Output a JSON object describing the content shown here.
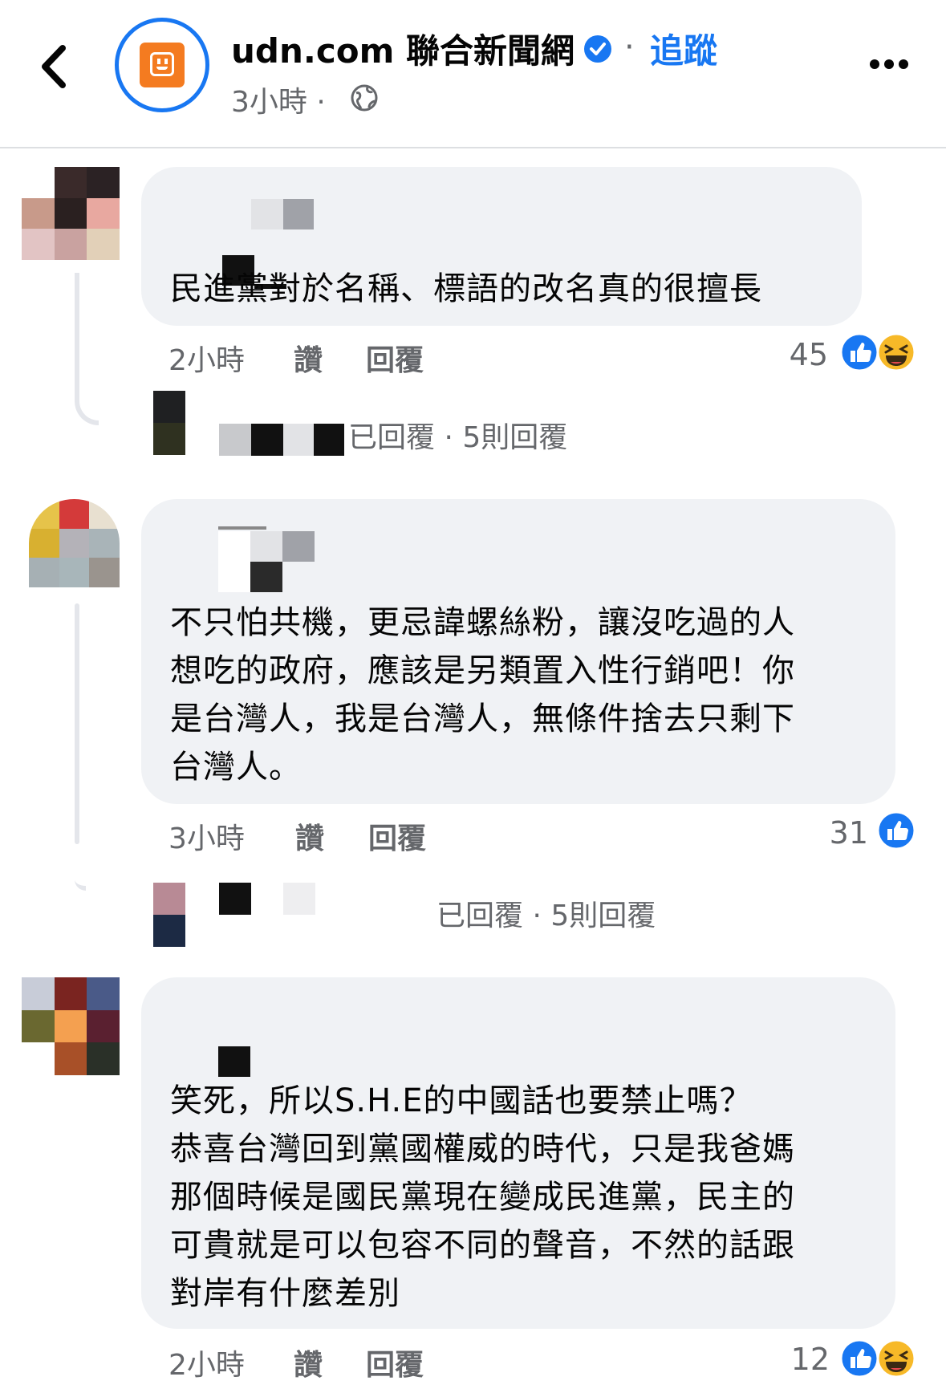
{
  "header": {
    "page_name": "udn.com 聯合新聞網",
    "separator": "·",
    "follow_label": "追蹤",
    "post_time": "3小時 ·",
    "accent_color": "#1877f2",
    "logo_color": "#f47b20"
  },
  "comments": [
    {
      "text": "民進黨對於名稱、標語的改名真的很擅長",
      "time": "2小時",
      "like_label": "讚",
      "reply_label": "回覆",
      "reaction_count": "45",
      "reactions": [
        "like-icon",
        "haha-icon"
      ],
      "replies_summary": "已回覆 · 5則回覆"
    },
    {
      "text_lines": [
        "不只怕共機，更忌諱螺絲粉，讓沒吃過的人",
        "想吃的政府，應該是另類置入性行銷吧！你",
        "是台灣人，我是台灣人，無條件捨去只剩下",
        "台灣人。"
      ],
      "time": "3小時",
      "like_label": "讚",
      "reply_label": "回覆",
      "reaction_count": "31",
      "reactions": [
        "like-icon"
      ],
      "replies_summary": "已回覆 · 5則回覆"
    },
    {
      "text_lines": [
        "笑死，所以S.H.E的中國話也要禁止嗎？",
        "恭喜台灣回到黨國權威的時代，只是我爸媽",
        "那個時候是國民黨現在變成民進黨，民主的",
        "可貴就是可以包容不同的聲音，不然的話跟",
        "對岸有什麼差別"
      ],
      "time": "2小時",
      "like_label": "讚",
      "reply_label": "回覆",
      "reaction_count": "12",
      "reactions": [
        "like-icon",
        "haha-icon"
      ]
    }
  ]
}
